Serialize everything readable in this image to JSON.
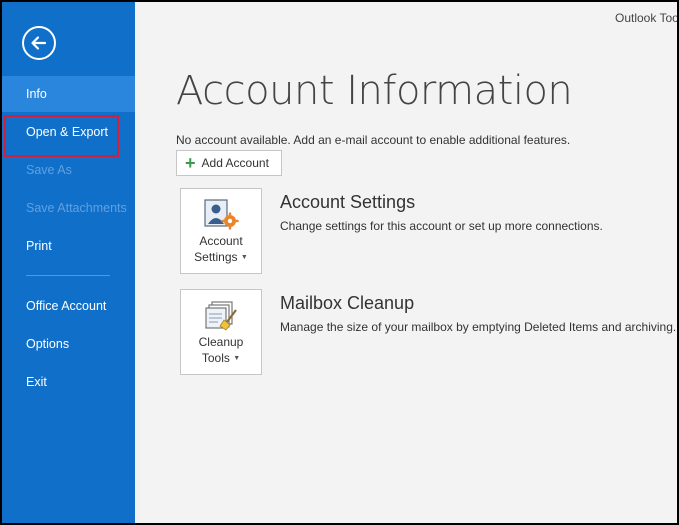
{
  "app_title": "Outlook Too",
  "sidebar": {
    "items": [
      {
        "label": "Info"
      },
      {
        "label": "Open & Export"
      },
      {
        "label": "Save As"
      },
      {
        "label": "Save Attachments"
      },
      {
        "label": "Print"
      },
      {
        "label": "Office Account"
      },
      {
        "label": "Options"
      },
      {
        "label": "Exit"
      }
    ],
    "colors": {
      "background": "#1070c9",
      "active": "#2a86dd",
      "highlight_border": "#d21f3c"
    }
  },
  "main": {
    "title": "Account Information",
    "subtitle": "No account available. Add an e-mail account to enable additional features.",
    "add_account_label": "Add Account",
    "sections": [
      {
        "tile_line1": "Account",
        "tile_line2": "Settings",
        "title": "Account Settings",
        "description": "Change settings for this account or set up more connections."
      },
      {
        "tile_line1": "Cleanup",
        "tile_line2": "Tools",
        "title": "Mailbox Cleanup",
        "description": "Manage the size of your mailbox by emptying Deleted Items and archiving."
      }
    ]
  }
}
